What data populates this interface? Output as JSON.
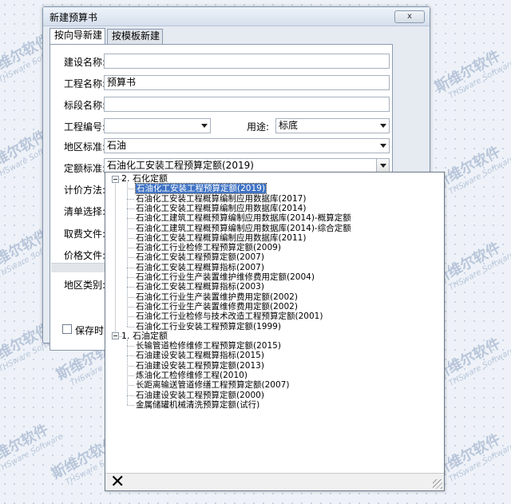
{
  "watermark": {
    "cn": "斯维尔软件",
    "en": "THSware Software"
  },
  "dialog": {
    "title": "新建预算书",
    "close_label": "x",
    "tabs": [
      {
        "label": "按向导新建",
        "active": true
      },
      {
        "label": "按模板新建",
        "active": false
      }
    ]
  },
  "form": {
    "construction_name_label": "建设名称:",
    "construction_name_value": "",
    "project_name_label": "工程名称:",
    "project_name_value": "预算书",
    "section_name_label": "标段名称:",
    "section_name_value": "",
    "project_no_label": "工程编号:",
    "project_no_value": "",
    "usage_label": "用途:",
    "usage_value": "标底",
    "region_standard_label": "地区标准:",
    "region_standard_value": "石油",
    "quota_standard_label": "定额标准:",
    "quota_standard_value": "石油化工安装工程预算定额(2019)",
    "pricing_label": "计价方法:",
    "bill_select_label": "清单选择:",
    "fee_file_label": "取费文件:",
    "price_file_label": "价格文件:",
    "region_type_label": "地区类别:",
    "save_label": "保存时"
  },
  "dropdown": {
    "groups": [
      {
        "label": "2. 石化定额",
        "items": [
          "石油化工安装工程预算定额(2019)",
          "石油化工安装工程概算编制应用数据库(2017)",
          "石油化工安装工程概算编制应用数据库(2014)",
          "石油化工建筑工程概预算编制应用数据库(2014)-概算定额",
          "石油化工建筑工程概预算编制应用数据库(2014)-综合定额",
          "石油化工安装工程概算编制应用数据库(2011)",
          "石油化工行业检修工程预算定额(2009)",
          "石油化工安装工程预算定额(2007)",
          "石油化工安装工程概算指标(2007)",
          "石油化工行业生产装置维护维修费用定额(2004)",
          "石油化工安装工程概算指标(2003)",
          "石油化工行业生产装置维护费用定额(2002)",
          "石油化工行业生产装置维修费用定额(2002)",
          "石油化工行业检修与技术改造工程预算定额(2001)",
          "石油化工行业安装工程预算定额(1999)"
        ]
      },
      {
        "label": "1. 石油定额",
        "items": [
          "长输管道检修维修工程预算定额(2015)",
          "石油建设安装工程概算指标(2015)",
          "石油建设安装工程预算定额(2013)",
          "炼油化工检修维修工程(2010)",
          "长距离输送管道修缮工程预算定额(2007)",
          "石油建设安装工程预算定额(2000)",
          "金属储罐机械清洗预算定额(试行)"
        ]
      }
    ],
    "selected_item": "石油化工安装工程预算定额(2019)",
    "close_glyph": "✕"
  }
}
